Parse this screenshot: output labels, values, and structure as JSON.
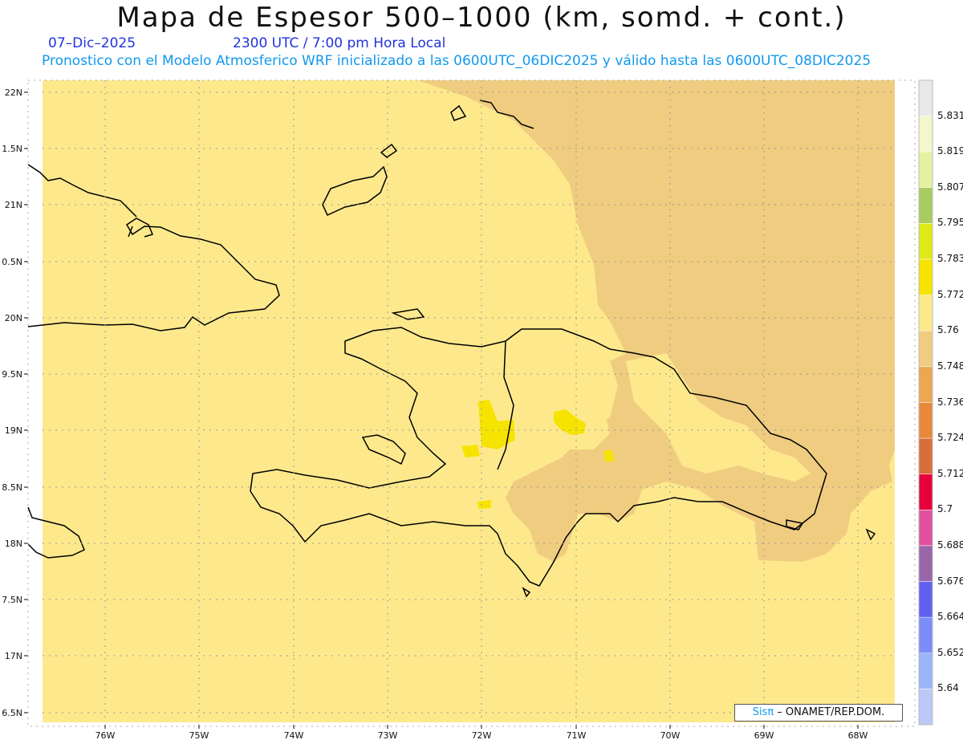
{
  "title": "Mapa de Espesor 500–1000 (km, somd. + cont.)",
  "date": "07–Dic–2025",
  "time": "2300 UTC / 7:00 pm Hora Local",
  "forecast": "Pronostico con el Modelo Atmosferico WRF inicializado a las 0600UTC_06DIC2025 y válido hasta las  0600UTC_08DIC2025",
  "lat_labels": [
    "22N",
    "1.5N",
    "21N",
    "0.5N",
    "20N",
    "9.5N",
    "19N",
    "8.5N",
    "18N",
    "7.5N",
    "17N",
    "6.5N"
  ],
  "lon_labels": [
    "76W",
    "75W",
    "74W",
    "73W",
    "72W",
    "71W",
    "70W",
    "69W",
    "68W"
  ],
  "colorbar": {
    "labels": [
      "5.831",
      "5.819",
      "5.807",
      "5.795",
      "5.783",
      "5.772",
      "5.76",
      "5.748",
      "5.736",
      "5.724",
      "5.712",
      "5.7",
      "5.688",
      "5.676",
      "5.664",
      "5.652",
      "5.64"
    ],
    "colors": [
      "#e8e8e8",
      "#f4f6cc",
      "#e2f2a0",
      "#a8cc60",
      "#dfe818",
      "#f6e400",
      "#fde98c",
      "#f0cc80",
      "#eca752",
      "#e8883a",
      "#d86e3a",
      "#e8003c",
      "#e0509e",
      "#9966aa",
      "#6060f0",
      "#7c8cf8",
      "#9ab4f8",
      "#bcc8f8"
    ]
  },
  "fill_colors": {
    "base": "#fde98c",
    "darker": "#f0cc80",
    "yellow": "#f6e400"
  },
  "credit": {
    "brand": "Sisπ",
    "org": " – ONAMET/REP.DOM."
  }
}
